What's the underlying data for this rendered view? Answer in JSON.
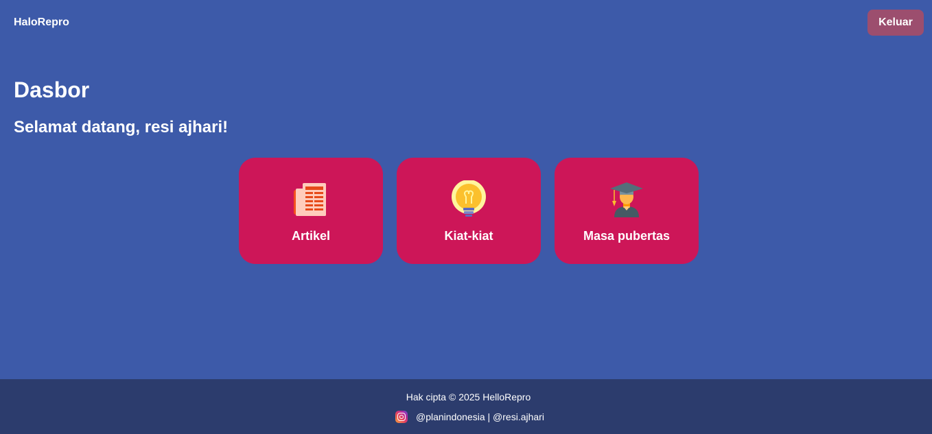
{
  "header": {
    "brand": "HaloRepro",
    "logout_label": "Keluar"
  },
  "main": {
    "title": "Dasbor",
    "welcome": "Selamat datang, resi ajhari!",
    "cards": [
      {
        "label": "Artikel",
        "icon": "newspaper-icon"
      },
      {
        "label": "Kiat-kiat",
        "icon": "lightbulb-icon"
      },
      {
        "label": "Masa pubertas",
        "icon": "graduate-icon"
      }
    ]
  },
  "footer": {
    "copyright": "Hak cipta © 2025 HelloRepro",
    "social_icon": "instagram-icon",
    "handles": "@planindonesia | @resi.ajhari"
  },
  "colors": {
    "background": "#3d5aa9",
    "card": "#cd1658",
    "logout_button": "#9c4e6e",
    "footer": "#2c3c6d"
  }
}
